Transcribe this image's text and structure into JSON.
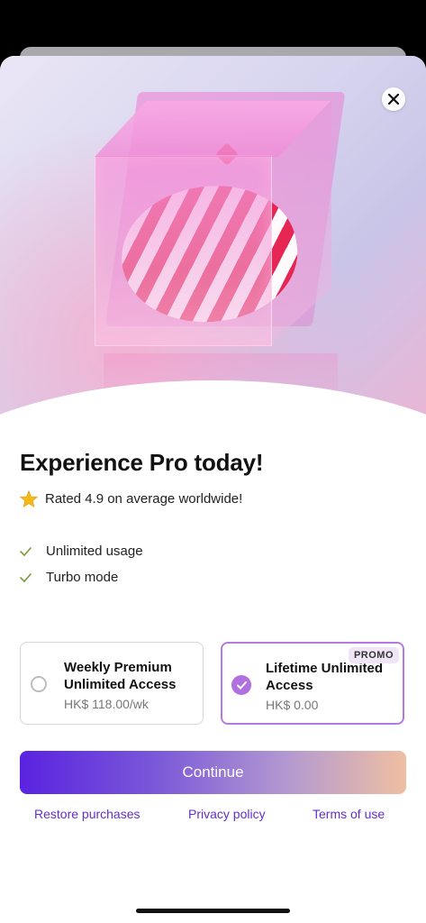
{
  "paywall": {
    "title": "Experience Pro today!",
    "rating_text": "Rated 4.9 on average worldwide!",
    "features": [
      "Unlimited usage",
      "Turbo mode"
    ],
    "plans": [
      {
        "name": "Weekly Premium Unlimited Access",
        "price": "HK$ 118.00/wk",
        "selected": false
      },
      {
        "name": "Lifetime Unlimited Access",
        "price": "HK$ 0.00",
        "selected": true,
        "badge": "PROMO"
      }
    ],
    "continue_label": "Continue",
    "links": {
      "restore": "Restore purchases",
      "privacy": "Privacy policy",
      "terms": "Terms of use"
    }
  },
  "icons": {
    "close": "close-icon",
    "rating": "star-icon",
    "feature": "checkmark-icon",
    "selected": "check-circle-icon"
  },
  "colors": {
    "accent": "#b070e0",
    "link": "#6230c9",
    "button_start": "#5a22e0",
    "button_end": "#efbfa2",
    "star": "#f6b91a",
    "check": "#7a9a3a"
  }
}
